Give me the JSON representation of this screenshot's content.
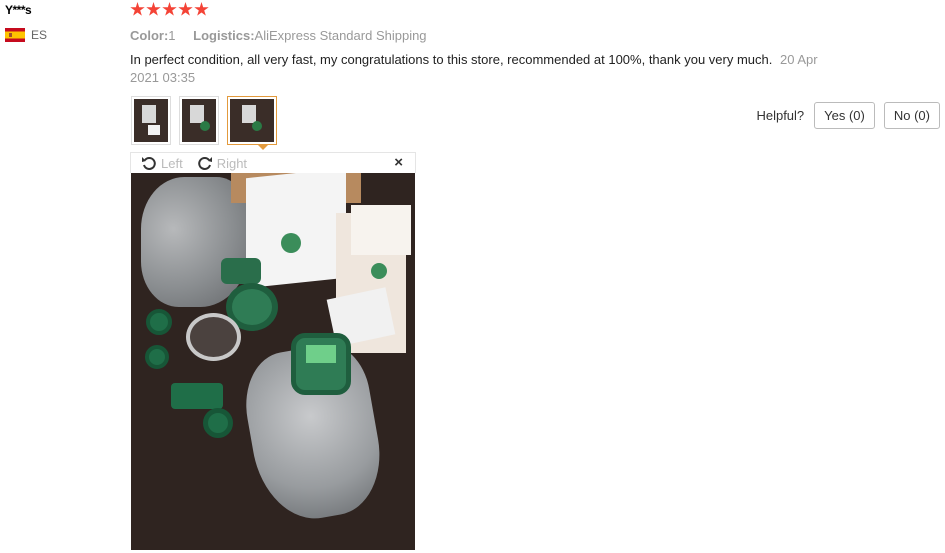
{
  "user": {
    "name": "Y***s",
    "country_code": "ES"
  },
  "review": {
    "rating": 5,
    "attributes": [
      {
        "label": "Color:",
        "value": "1"
      },
      {
        "label": "Logistics:",
        "value": "AliExpress Standard Shipping"
      }
    ],
    "text": "In perfect condition, all very fast, my congratulations to this store, recommended at 100%, thank you very much.",
    "date": "20 Apr 2021 03:35"
  },
  "viewer": {
    "rotate_left": "Left",
    "rotate_right": "Right",
    "close": "×",
    "thumbnail_count": 3,
    "selected_index": 3
  },
  "helpful": {
    "label": "Helpful?",
    "yes": "Yes (0)",
    "no": "No (0)"
  },
  "colors": {
    "star": "#f44336",
    "active_thumb_border": "#e39a3c"
  }
}
